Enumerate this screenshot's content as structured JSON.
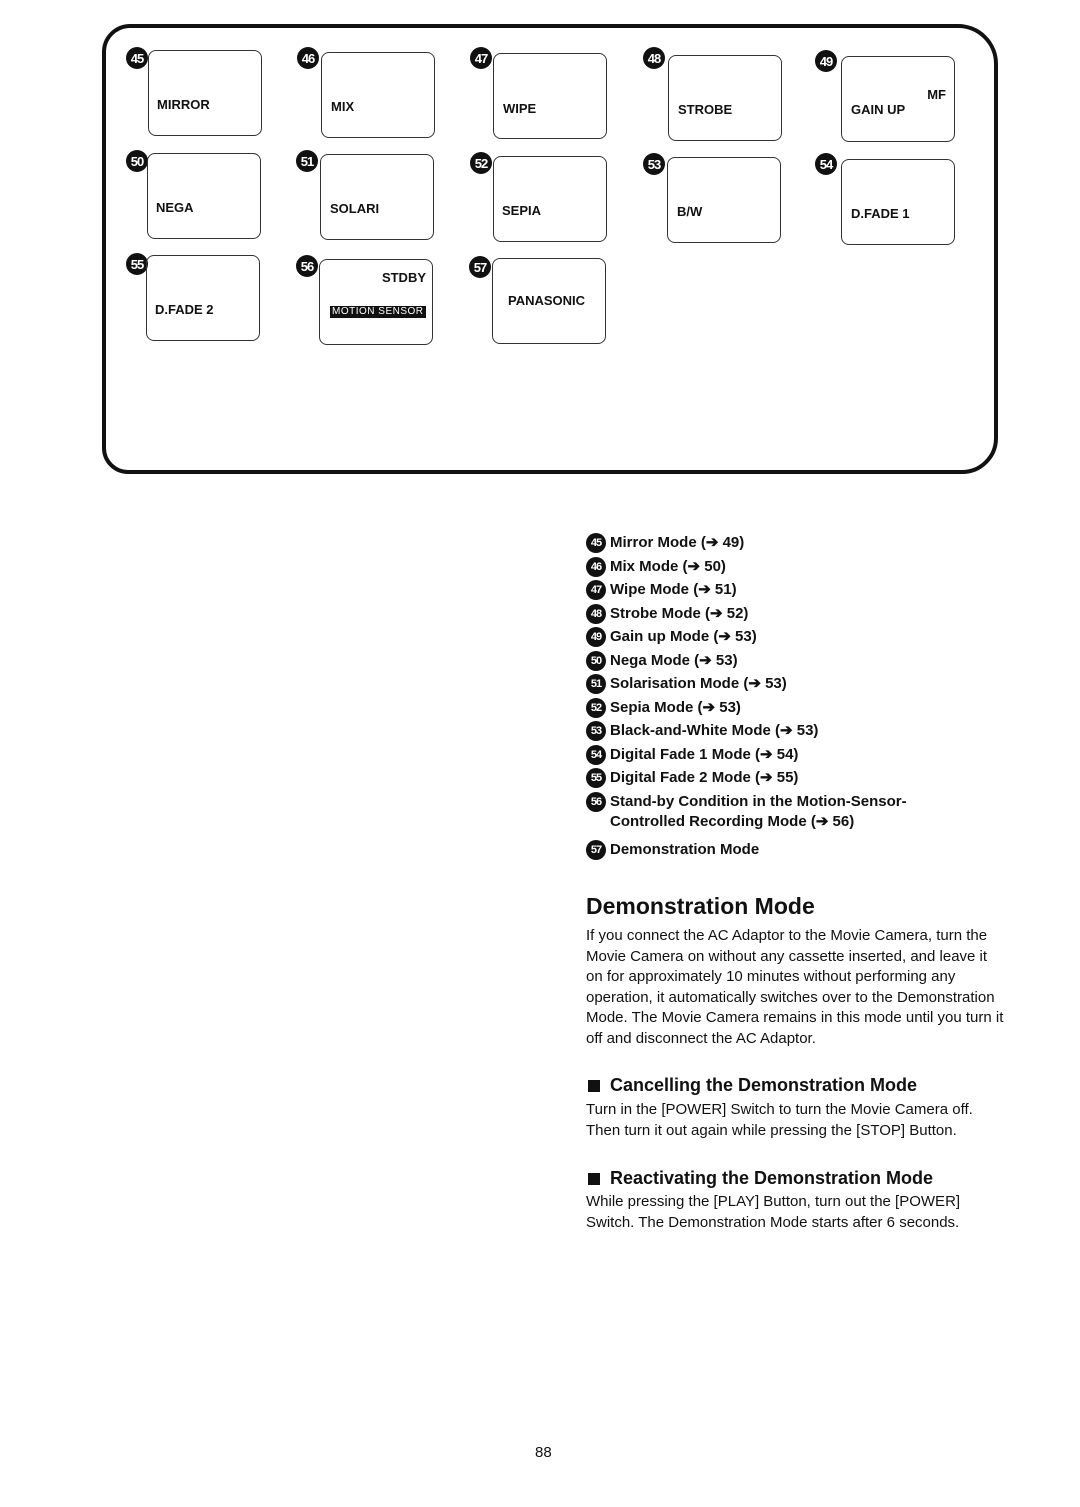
{
  "diagram": {
    "screens": [
      {
        "num": "45",
        "label": "MIRROR"
      },
      {
        "num": "46",
        "label": "MIX"
      },
      {
        "num": "47",
        "label": "WIPE"
      },
      {
        "num": "48",
        "label": "STROBE"
      },
      {
        "num": "49",
        "label": "GAIN UP",
        "extra": "MF"
      },
      {
        "num": "50",
        "label": "NEGA"
      },
      {
        "num": "51",
        "label": "SOLARI"
      },
      {
        "num": "52",
        "label": "SEPIA"
      },
      {
        "num": "53",
        "label": "B/W"
      },
      {
        "num": "54",
        "label": "D.FADE 1"
      },
      {
        "num": "55",
        "label": "D.FADE 2"
      },
      {
        "num": "56",
        "label": "STDBY",
        "extra": "MOTION SENSOR"
      },
      {
        "num": "57",
        "label": "PANASONIC"
      }
    ]
  },
  "legend": [
    {
      "num": "45",
      "text": "Mirror Mode (➔ 49)"
    },
    {
      "num": "46",
      "text": "Mix Mode (➔ 50)"
    },
    {
      "num": "47",
      "text": "Wipe Mode (➔ 51)"
    },
    {
      "num": "48",
      "text": "Strobe Mode (➔ 52)"
    },
    {
      "num": "49",
      "text": "Gain up Mode (➔ 53)"
    },
    {
      "num": "50",
      "text": "Nega Mode (➔ 53)"
    },
    {
      "num": "51",
      "text": "Solarisation Mode (➔ 53)"
    },
    {
      "num": "52",
      "text": "Sepia Mode (➔ 53)"
    },
    {
      "num": "53",
      "text": "Black-and-White Mode (➔ 53)"
    },
    {
      "num": "54",
      "text": "Digital Fade 1 Mode (➔ 54)"
    },
    {
      "num": "55",
      "text": "Digital Fade 2 Mode (➔ 55)"
    },
    {
      "num": "56",
      "text": "Stand-by Condition in the Motion-Sensor-Controlled Recording Mode (➔ 56)"
    },
    {
      "num": "57",
      "text": "Demonstration Mode"
    }
  ],
  "section": {
    "title": "Demonstration Mode",
    "intro": "If you connect the AC Adaptor to the Movie Camera, turn the Movie Camera on without any cassette inserted, and leave it on for approximately 10 minutes without performing any operation, it automatically switches over to the Demonstration Mode. The Movie Camera remains in this mode until you turn it off and disconnect the AC Adaptor.",
    "cancel_title": "Cancelling the Demonstration Mode",
    "cancel_text": "Turn in the [POWER] Switch to turn the Movie Camera off. Then turn it out again while pressing the [STOP] Button.",
    "reactivate_title": "Reactivating the Demonstration Mode",
    "reactivate_text": "While pressing the [PLAY] Button, turn out the [POWER] Switch. The Demonstration Mode starts after 6 seconds."
  },
  "page_number": "88"
}
